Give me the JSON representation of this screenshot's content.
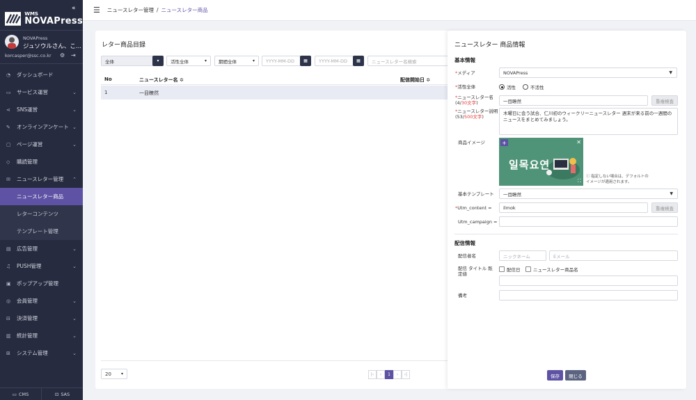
{
  "logo": {
    "wms": "WMS",
    "name": "NOVAPress",
    "collapse": "«"
  },
  "user": {
    "company": "NOVAPress",
    "name": "ジュソウルさん、こ...",
    "email": "korcasper@ssc.co.kr"
  },
  "menu": [
    {
      "label": "ダッシュボード",
      "icon": "dashboard-icon",
      "chev": false
    },
    {
      "label": "サービス運営",
      "icon": "service-icon",
      "chev": true
    },
    {
      "label": "SNS運営",
      "icon": "share-icon",
      "chev": true
    },
    {
      "label": "オンラインアンケート",
      "icon": "survey-icon",
      "chev": true
    },
    {
      "label": "ページ運営",
      "icon": "page-icon",
      "chev": true
    },
    {
      "label": "購読管理",
      "icon": "tag-icon",
      "chev": false
    },
    {
      "label": "ニュースレター管理",
      "icon": "mail-icon",
      "chev": true
    }
  ],
  "submenu": [
    {
      "label": "ニュースレター商品",
      "active": true
    },
    {
      "label": "レターコンテンツ",
      "active": false
    },
    {
      "label": "テンプレート管理",
      "active": false
    }
  ],
  "menu2": [
    {
      "label": "広告管理",
      "icon": "ad-icon",
      "chev": true
    },
    {
      "label": "PUSH管理",
      "icon": "bell-icon",
      "chev": true
    },
    {
      "label": "ポップアップ管理",
      "icon": "popup-icon",
      "chev": false
    },
    {
      "label": "会員管理",
      "icon": "user-icon",
      "chev": true
    },
    {
      "label": "決済管理",
      "icon": "payment-icon",
      "chev": true
    },
    {
      "label": "統計管理",
      "icon": "chart-icon",
      "chev": true
    },
    {
      "label": "システム管理",
      "icon": "system-icon",
      "chev": true
    }
  ],
  "footer": {
    "cms": "CMS",
    "sas": "SAS"
  },
  "breadcrumb": {
    "parent": "ニュースレター管理",
    "sep": "/",
    "current": "ニュースレター商品"
  },
  "list": {
    "title": "レター商品目録",
    "filters": {
      "category": "全体",
      "status": "活性全体",
      "period": "期間全体",
      "date_from": "YYYY-MM-DD",
      "date_to": "YYYY-MM-DD",
      "search_placeholder": "ニュースレター名検索"
    },
    "columns": {
      "no": "No",
      "name": "ニュースレター名 ≎",
      "start": "配信開始日 ≎"
    },
    "rows": [
      {
        "no": "1",
        "name": "一目瞭然"
      }
    ],
    "page_size": "20",
    "pagination": {
      "first": "|‹",
      "prev": "‹",
      "current": "1",
      "next": "›",
      "last": "›|"
    }
  },
  "detail": {
    "title": "ニュースレター 商品情報",
    "basic_section": "基本情報",
    "media_label": "メディア",
    "media_value": "NOVAPress",
    "status_label": "活性全体",
    "status_active": "活性",
    "status_inactive": "不活性",
    "name_label": "ニュースレター名",
    "name_count_pre": "(4/",
    "name_count_max": "30文字",
    "name_count_post": ")",
    "name_value": "一目瞭然",
    "dup_check": "重複検査",
    "desc_label": "ニュースレター説明",
    "desc_count_pre": "(53/",
    "desc_count_max": "500文字",
    "desc_count_post": ")",
    "desc_value": "木曜日に会う試合、仁川初のウィークリーニュースレター 週末が来る前の一週間のニュースをまとめてみましょう。",
    "image_label": "商品イメージ",
    "image_text": "일목요연",
    "image_note": "ⓘ 指定しない場合は、デフォルトのイメージが適用されます。",
    "template_label": "基本テンプレート",
    "template_value": "一目瞭然",
    "utm_content_label": "Utm_content",
    "utm_content_value": "ilmok",
    "utm_campaign_label": "Utm_campaign",
    "delivery_section": "配信情報",
    "sender_label": "配信者名",
    "nickname_placeholder": "ニックネーム",
    "email_placeholder": "Eメール",
    "title_default_label": "配信 タイトル 既定値",
    "opt_date": "配信日",
    "opt_name": "ニュースレター商品名",
    "note_label": "備考",
    "save": "保存",
    "close": "閉じる"
  },
  "colors": {
    "accent": "#5d52a4",
    "sidebar": "#262b3f"
  }
}
